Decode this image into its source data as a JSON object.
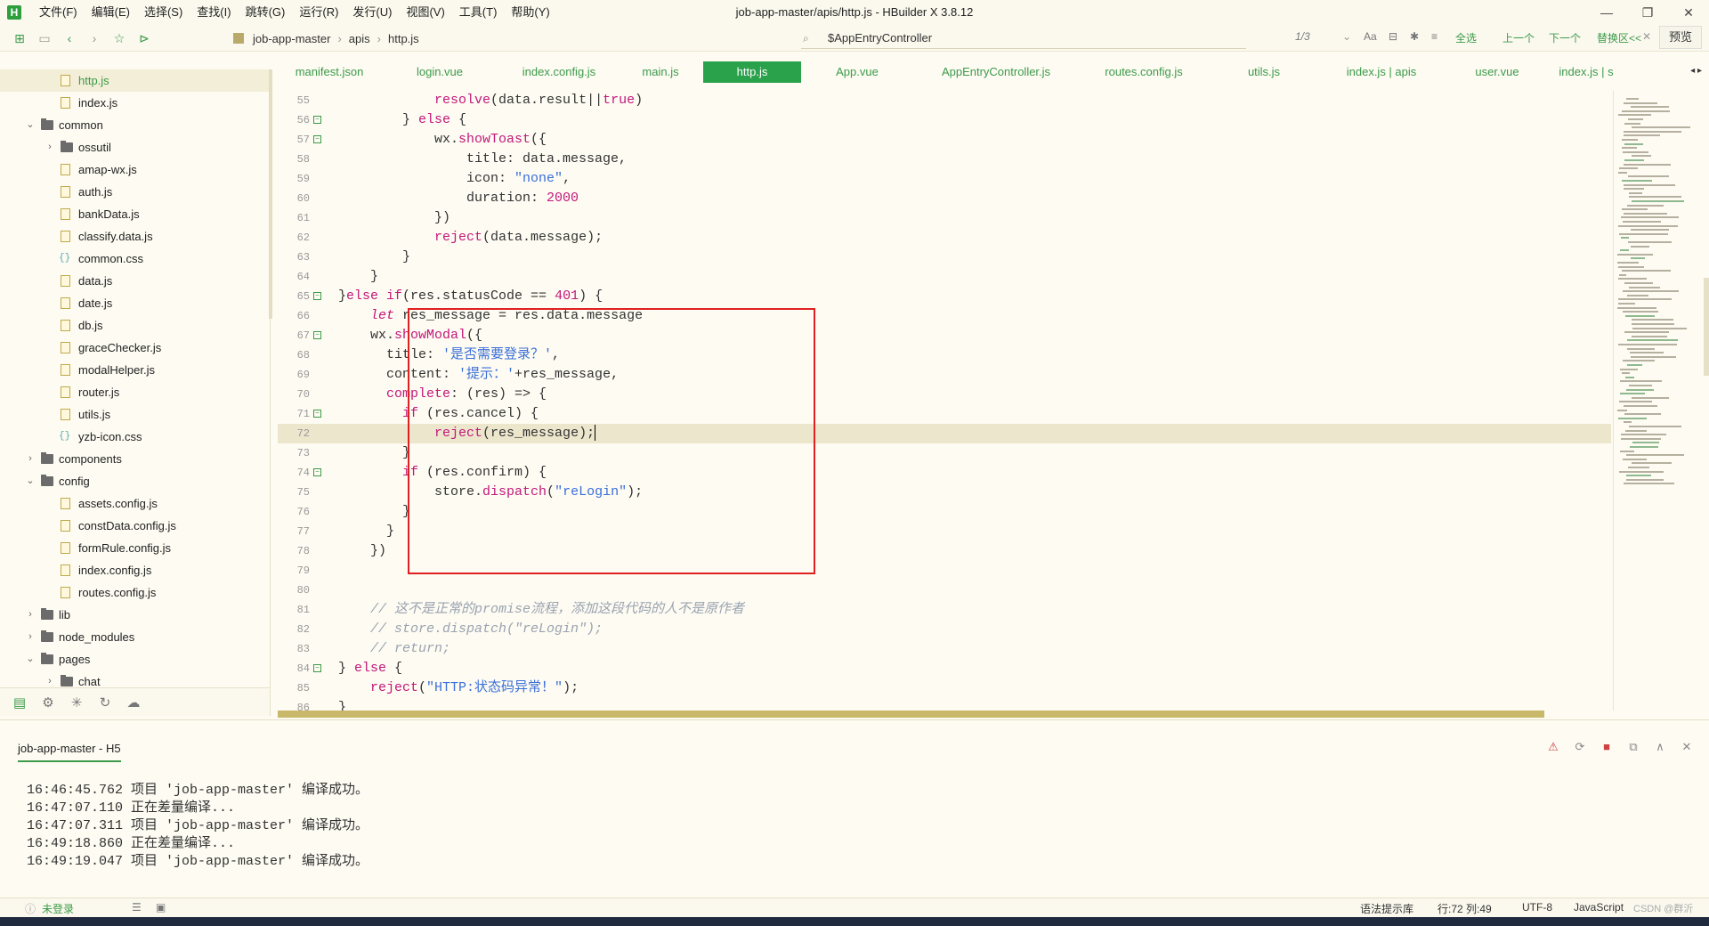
{
  "app": {
    "logo_letter": "H",
    "window_title": "job-app-master/apis/http.js - HBuilder X 3.8.12",
    "menu": [
      "文件(F)",
      "编辑(E)",
      "选择(S)",
      "查找(I)",
      "跳转(G)",
      "运行(R)",
      "发行(U)",
      "视图(V)",
      "工具(T)",
      "帮助(Y)"
    ]
  },
  "toolbar": {
    "breadcrumb": [
      "job-app-master",
      "apis",
      "http.js"
    ],
    "search_value": "$AppEntryController",
    "search_counter": "1/3",
    "search_options": [
      "Aa",
      "全选",
      "上一个",
      "下一个",
      "替换区<<"
    ],
    "preview_label": "预览"
  },
  "sidebar": {
    "items": [
      {
        "label": "http.js",
        "type": "file",
        "depth": 2,
        "selected": true
      },
      {
        "label": "index.js",
        "type": "file",
        "depth": 2
      },
      {
        "label": "common",
        "type": "folder",
        "depth": 1,
        "expanded": true
      },
      {
        "label": "ossutil",
        "type": "folder",
        "depth": 2,
        "expanded": false
      },
      {
        "label": "amap-wx.js",
        "type": "file",
        "depth": 2
      },
      {
        "label": "auth.js",
        "type": "file",
        "depth": 2
      },
      {
        "label": "bankData.js",
        "type": "file",
        "depth": 2
      },
      {
        "label": "classify.data.js",
        "type": "file",
        "depth": 2
      },
      {
        "label": "common.css",
        "type": "css",
        "depth": 2
      },
      {
        "label": "data.js",
        "type": "file",
        "depth": 2
      },
      {
        "label": "date.js",
        "type": "file",
        "depth": 2
      },
      {
        "label": "db.js",
        "type": "file",
        "depth": 2
      },
      {
        "label": "graceChecker.js",
        "type": "file",
        "depth": 2
      },
      {
        "label": "modalHelper.js",
        "type": "file",
        "depth": 2
      },
      {
        "label": "router.js",
        "type": "file",
        "depth": 2
      },
      {
        "label": "utils.js",
        "type": "file",
        "depth": 2
      },
      {
        "label": "yzb-icon.css",
        "type": "css",
        "depth": 2
      },
      {
        "label": "components",
        "type": "folder",
        "depth": 1,
        "expanded": false
      },
      {
        "label": "config",
        "type": "folder",
        "depth": 1,
        "expanded": true
      },
      {
        "label": "assets.config.js",
        "type": "file",
        "depth": 2
      },
      {
        "label": "constData.config.js",
        "type": "file",
        "depth": 2
      },
      {
        "label": "formRule.config.js",
        "type": "file",
        "depth": 2
      },
      {
        "label": "index.config.js",
        "type": "file",
        "depth": 2
      },
      {
        "label": "routes.config.js",
        "type": "file",
        "depth": 2
      },
      {
        "label": "lib",
        "type": "folder",
        "depth": 1,
        "expanded": false
      },
      {
        "label": "node_modules",
        "type": "folder",
        "depth": 1,
        "expanded": false
      },
      {
        "label": "pages",
        "type": "folder",
        "depth": 1,
        "expanded": true
      },
      {
        "label": "chat",
        "type": "folder",
        "depth": 2,
        "expanded": false
      }
    ]
  },
  "tabs": [
    {
      "label": "manifest.json"
    },
    {
      "label": "login.vue"
    },
    {
      "label": "index.config.js"
    },
    {
      "label": "main.js"
    },
    {
      "label": "http.js",
      "active": true
    },
    {
      "label": "App.vue"
    },
    {
      "label": "AppEntryController.js"
    },
    {
      "label": "routes.config.js"
    },
    {
      "label": "utils.js"
    },
    {
      "label": "index.js | apis"
    },
    {
      "label": "user.vue"
    },
    {
      "label": "index.js | s"
    }
  ],
  "editor": {
    "lines": [
      {
        "n": "55",
        "fold": false,
        "html": "            <span class=\"fn\">resolve</span>(data.result||<span class=\"kw\">true</span>)"
      },
      {
        "n": "56",
        "fold": true,
        "html": "        } <span class=\"kw\">else</span> {"
      },
      {
        "n": "57",
        "fold": true,
        "html": "            wx.<span class=\"fn\">showToast</span>({"
      },
      {
        "n": "58",
        "fold": false,
        "html": "                title: data.message,"
      },
      {
        "n": "59",
        "fold": false,
        "html": "                icon: <span class=\"str\">\"none\"</span>,"
      },
      {
        "n": "60",
        "fold": false,
        "html": "                duration: <span class=\"num\">2000</span>"
      },
      {
        "n": "61",
        "fold": false,
        "html": "            })"
      },
      {
        "n": "62",
        "fold": false,
        "html": "            <span class=\"fn\">reject</span>(data.message);"
      },
      {
        "n": "63",
        "fold": false,
        "html": "        }"
      },
      {
        "n": "64",
        "fold": false,
        "html": "    }"
      },
      {
        "n": "65",
        "fold": true,
        "html": "}<span class=\"kw\">else if</span>(res.statusCode == <span class=\"num\">401</span>) {"
      },
      {
        "n": "66",
        "fold": false,
        "html": "    <span class=\"kw\" style=\"font-style:italic\">let</span> res_message = res.data.message"
      },
      {
        "n": "67",
        "fold": true,
        "html": "    wx.<span class=\"fn\">showModal</span>({"
      },
      {
        "n": "68",
        "fold": false,
        "html": "      title: <span class=\"str\">'是否需要登录？'</span>,"
      },
      {
        "n": "69",
        "fold": false,
        "html": "      content: <span class=\"str\">'提示：'</span>+res_message,"
      },
      {
        "n": "70",
        "fold": false,
        "html": "      <span class=\"fn\">complete</span>: (res) => {"
      },
      {
        "n": "71",
        "fold": true,
        "html": "        <span class=\"kw\">if</span> (res.cancel) {"
      },
      {
        "n": "72",
        "fold": false,
        "current": true,
        "html": "            <span class=\"fn\">reject</span>(res_message);<span class=\"caret\"></span>"
      },
      {
        "n": "73",
        "fold": false,
        "html": "        }"
      },
      {
        "n": "74",
        "fold": true,
        "html": "        <span class=\"kw\">if</span> (res.confirm) {"
      },
      {
        "n": "75",
        "fold": false,
        "html": "            store.<span class=\"fn\">dispatch</span>(<span class=\"str\">\"reLogin\"</span>);"
      },
      {
        "n": "76",
        "fold": false,
        "html": "        }"
      },
      {
        "n": "77",
        "fold": false,
        "html": "      }"
      },
      {
        "n": "78",
        "fold": false,
        "html": "    })"
      },
      {
        "n": "79",
        "fold": false,
        "html": ""
      },
      {
        "n": "80",
        "fold": false,
        "html": ""
      },
      {
        "n": "81",
        "fold": false,
        "html": "    <span class=\"cmt\">// 这不是正常的promise流程，添加这段代码的人不是原作者</span>"
      },
      {
        "n": "82",
        "fold": false,
        "html": "    <span class=\"cmt\">// store.dispatch(\"reLogin\");</span>"
      },
      {
        "n": "83",
        "fold": false,
        "html": "    <span class=\"cmt\">// return;</span>"
      },
      {
        "n": "84",
        "fold": true,
        "html": "} <span class=\"kw\">else</span> {"
      },
      {
        "n": "85",
        "fold": false,
        "html": "    <span class=\"fn\">reject</span>(<span class=\"str\">\"HTTP:状态码异常！\"</span>);"
      },
      {
        "n": "86",
        "fold": false,
        "html": "}"
      }
    ]
  },
  "console": {
    "tab_label": "job-app-master - H5",
    "logs": [
      "16:46:45.762 项目 'job-app-master' 编译成功。",
      "16:47:07.110 正在差量编译...",
      "16:47:07.311 项目 'job-app-master' 编译成功。",
      "16:49:18.860 正在差量编译...",
      "16:49:19.047 项目 'job-app-master' 编译成功。"
    ]
  },
  "statusbar": {
    "login": "未登录",
    "syntax_lib": "语法提示库",
    "position": "行:72  列:49",
    "encoding": "UTF-8",
    "language": "JavaScript",
    "watermark": "CSDN @群沂"
  },
  "colors": {
    "accent": "#3c9a4a",
    "active_tab": "#2aa24b",
    "highlight_box": "#e02020",
    "background": "#fdfbf2"
  }
}
